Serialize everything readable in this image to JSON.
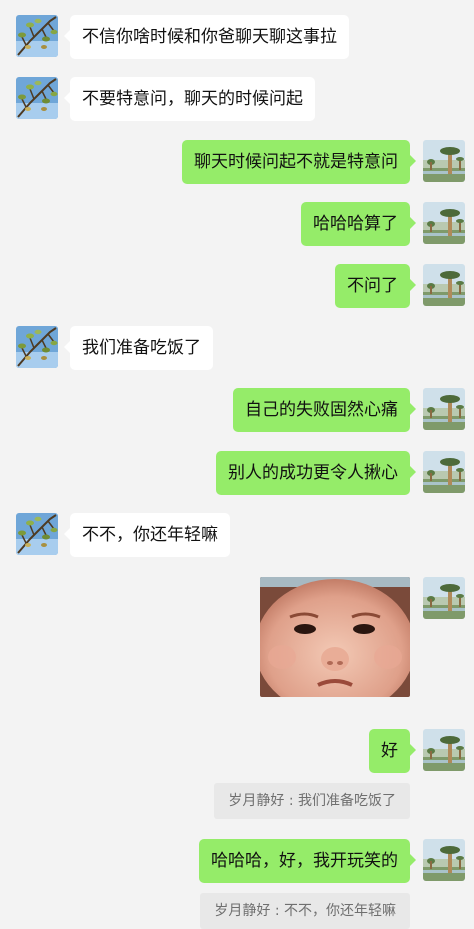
{
  "messages": [
    {
      "side": "left",
      "text": "不信你啥时候和你爸聊天聊这事拉"
    },
    {
      "side": "left",
      "text": "不要特意问，聊天的时候问起"
    },
    {
      "side": "right",
      "text": "聊天时候问起不就是特意问"
    },
    {
      "side": "right",
      "text": "哈哈哈算了"
    },
    {
      "side": "right",
      "text": "不问了"
    },
    {
      "side": "left",
      "text": "我们准备吃饭了"
    },
    {
      "side": "right",
      "text": "自己的失败固然心痛"
    },
    {
      "side": "right",
      "text": "别人的成功更令人揪心"
    },
    {
      "side": "left",
      "text": "不不，你还年轻嘛"
    },
    {
      "side": "right",
      "type": "sticker",
      "sticker": "crying-baby-face"
    },
    {
      "side": "right",
      "text": "好",
      "quote": "岁月静好 : 我们准备吃饭了"
    },
    {
      "side": "right",
      "text": "哈哈哈，好，我开玩笑的",
      "quote": "岁月静好 : 不不，你还年轻嘛"
    }
  ],
  "avatars": {
    "contact": "tree-branch-avatar",
    "self": "baobab-tree-avatar"
  },
  "colors": {
    "background": "#f3f3f3",
    "self_bubble": "#95ec69",
    "other_bubble": "#ffffff",
    "quote_bg": "#e8e8e8",
    "quote_text": "#6f6f6f"
  }
}
